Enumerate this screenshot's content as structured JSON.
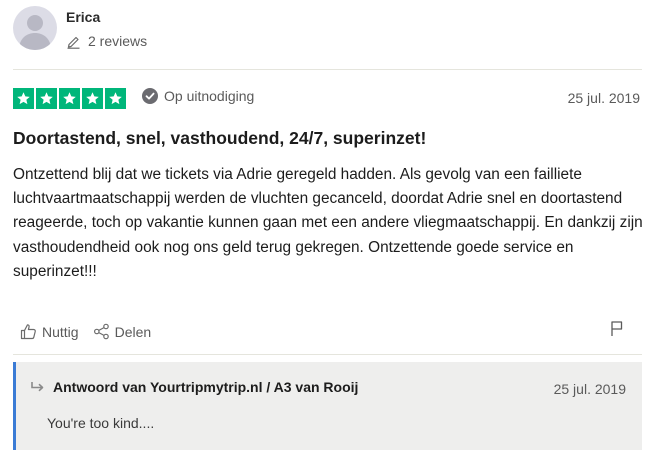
{
  "reviewer": {
    "name": "Erica",
    "review_count": "2 reviews",
    "avatar_icon": "user-silhouette-icon"
  },
  "rating": {
    "stars": 5,
    "max_stars": 5,
    "star_color": "#00b67a"
  },
  "badge": {
    "label": "Op uitnodiging",
    "icon": "check-circle-icon"
  },
  "date": "25 jul. 2019",
  "review": {
    "title": "Doortastend, snel, vasthoudend, 24/7, superinzet!",
    "body": "Ontzettend blij dat we tickets via Adrie geregeld hadden. Als gevolg van een failliete luchtvaartmaatschappij werden de vluchten gecanceld, doordat Adrie snel en doortastend reageerde, toch op vakantie kunnen gaan met een andere vliegmaatschappij. En dankzij zijn vasthoudendheid ook nog ons geld terug gekregen. Ontzettende goede service en superinzet!!!"
  },
  "actions": {
    "useful_label": "Nuttig",
    "share_label": "Delen",
    "report_icon": "flag-icon"
  },
  "reply": {
    "header": "Antwoord van Yourtripmytrip.nl / A3 van Rooij",
    "date": "25 jul. 2019",
    "text": "You're too kind....",
    "accent_color": "#3a7bd5"
  }
}
